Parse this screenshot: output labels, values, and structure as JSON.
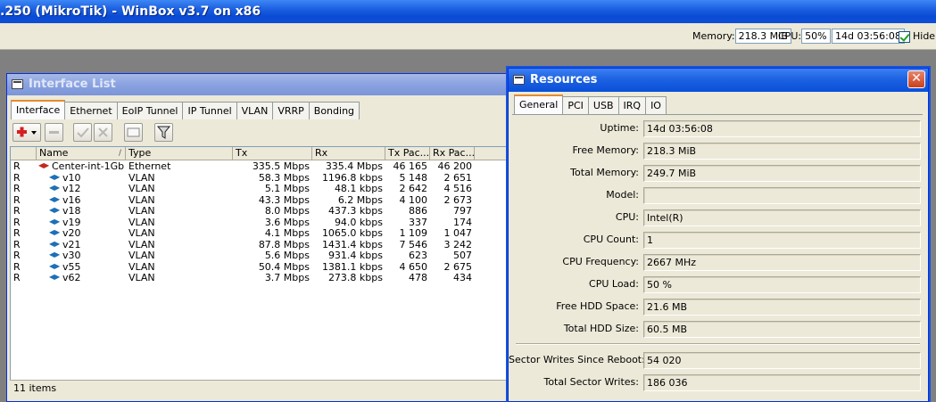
{
  "app": {
    "title": ".250 (MikroTik) - WinBox v3.7 on x86"
  },
  "toolbar": {
    "memory_label": "Memory:",
    "memory_value": "218.3 MiB",
    "cpu_label": "CPU:",
    "cpu_value": "50%",
    "uptime_value": "14d 03:56:08",
    "hide_label": "Hide",
    "hide_checked": true
  },
  "interface_window": {
    "title": "Interface List",
    "tabs": [
      "Interface",
      "Ethernet",
      "EoIP Tunnel",
      "IP Tunnel",
      "VLAN",
      "VRRP",
      "Bonding"
    ],
    "active_tab": "Interface",
    "columns": [
      "",
      "Name",
      "Type",
      "Tx",
      "Rx",
      "Tx Pac...",
      "Rx Pac..."
    ],
    "rows": [
      {
        "flag": "R",
        "name": "Center-int-1Gb",
        "icon": "ethernet-icon",
        "type": "Ethernet",
        "tx": "335.5 Mbps",
        "rx": "335.4 Mbps",
        "tx_pac": "46 165",
        "rx_pac": "46 200"
      },
      {
        "flag": "R",
        "name": "v10",
        "icon": "vlan-icon",
        "type": "VLAN",
        "tx": "58.3 Mbps",
        "rx": "1196.8 kbps",
        "tx_pac": "5 148",
        "rx_pac": "2 651"
      },
      {
        "flag": "R",
        "name": "v12",
        "icon": "vlan-icon",
        "type": "VLAN",
        "tx": "5.1 Mbps",
        "rx": "48.1 kbps",
        "tx_pac": "2 642",
        "rx_pac": "4 516"
      },
      {
        "flag": "R",
        "name": "v16",
        "icon": "vlan-icon",
        "type": "VLAN",
        "tx": "43.3 Mbps",
        "rx": "6.2 Mbps",
        "tx_pac": "4 100",
        "rx_pac": "2 673"
      },
      {
        "flag": "R",
        "name": "v18",
        "icon": "vlan-icon",
        "type": "VLAN",
        "tx": "8.0 Mbps",
        "rx": "437.3 kbps",
        "tx_pac": "886",
        "rx_pac": "797"
      },
      {
        "flag": "R",
        "name": "v19",
        "icon": "vlan-icon",
        "type": "VLAN",
        "tx": "3.6 Mbps",
        "rx": "94.0 kbps",
        "tx_pac": "337",
        "rx_pac": "174"
      },
      {
        "flag": "R",
        "name": "v20",
        "icon": "vlan-icon",
        "type": "VLAN",
        "tx": "4.1 Mbps",
        "rx": "1065.0 kbps",
        "tx_pac": "1 109",
        "rx_pac": "1 047"
      },
      {
        "flag": "R",
        "name": "v21",
        "icon": "vlan-icon",
        "type": "VLAN",
        "tx": "87.8 Mbps",
        "rx": "1431.4 kbps",
        "tx_pac": "7 546",
        "rx_pac": "3 242"
      },
      {
        "flag": "R",
        "name": "v30",
        "icon": "vlan-icon",
        "type": "VLAN",
        "tx": "5.6 Mbps",
        "rx": "931.4 kbps",
        "tx_pac": "623",
        "rx_pac": "507"
      },
      {
        "flag": "R",
        "name": "v55",
        "icon": "vlan-icon",
        "type": "VLAN",
        "tx": "50.4 Mbps",
        "rx": "1381.1 kbps",
        "tx_pac": "4 650",
        "rx_pac": "2 675"
      },
      {
        "flag": "R",
        "name": "v62",
        "icon": "vlan-icon",
        "type": "VLAN",
        "tx": "3.7 Mbps",
        "rx": "273.8 kbps",
        "tx_pac": "478",
        "rx_pac": "434"
      }
    ],
    "status": "11 items"
  },
  "resources_window": {
    "title": "Resources",
    "tabs": [
      "General",
      "PCI",
      "USB",
      "IRQ",
      "IO"
    ],
    "active_tab": "General",
    "fields": [
      {
        "label": "Uptime:",
        "value": "14d 03:56:08"
      },
      {
        "label": "Free Memory:",
        "value": "218.3 MiB"
      },
      {
        "label": "Total Memory:",
        "value": "249.7 MiB"
      },
      {
        "label": "Model:",
        "value": ""
      },
      {
        "label": "CPU:",
        "value": "Intel(R)"
      },
      {
        "label": "CPU Count:",
        "value": "1"
      },
      {
        "label": "CPU Frequency:",
        "value": "2667 MHz"
      },
      {
        "label": "CPU Load:",
        "value": "50 %"
      },
      {
        "label": "Free HDD Space:",
        "value": "21.6 MB"
      },
      {
        "label": "Total HDD Size:",
        "value": "60.5 MB"
      }
    ],
    "sector_fields": [
      {
        "label": "Sector Writes Since Reboot:",
        "value": "54 020"
      },
      {
        "label": "Total Sector Writes:",
        "value": "186 036"
      }
    ]
  },
  "colors": {
    "title_active": "#1d62e2",
    "title_inactive": "#8aa2e0",
    "window_bg": "#ece9d8",
    "desktop": "#808080",
    "tab_highlight": "#e68b2c"
  }
}
